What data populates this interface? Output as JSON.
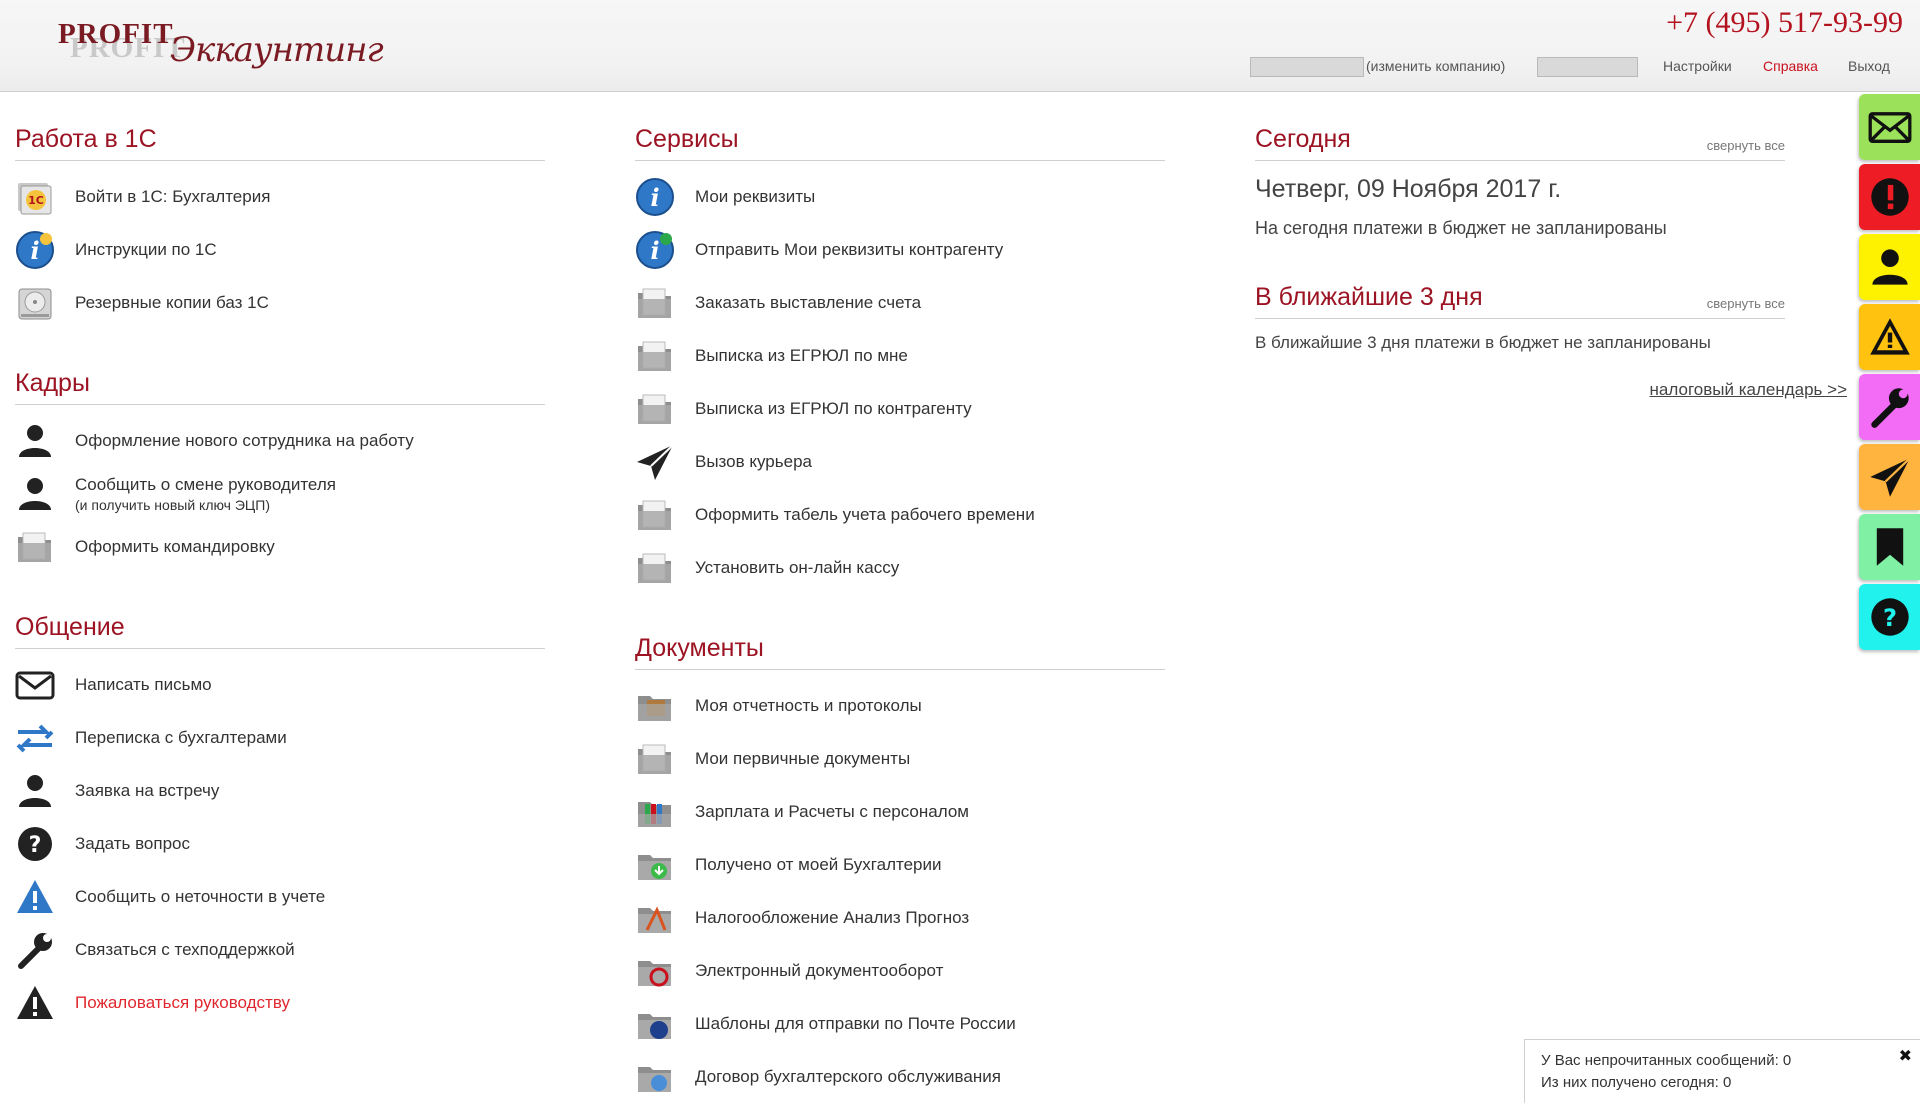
{
  "header": {
    "logo_profit": "PROFIT",
    "logo_script": "Экк­аунтинг",
    "phone": "+7 (495) 517-93-99",
    "change_company": "(изменить компанию)",
    "settings": "Настройки",
    "help": "Справка",
    "logout": "Выход"
  },
  "left": {
    "work_title": "Работа в 1С",
    "work_items": [
      "Войти в 1С: Бухгалтерия",
      "Инструкции по 1С",
      "Резервные копии баз 1С"
    ],
    "hr_title": "Кадры",
    "hr_items": [
      "Оформление нового сотрудника на работу",
      "Сообщить о смене руководителя",
      "(и получить новый ключ ЭЦП)",
      "Оформить командировку"
    ],
    "comm_title": "Общение",
    "comm_items": [
      "Написать письмо",
      "Переписка с бухгалтерами",
      "Заявка на встречу",
      "Задать вопрос",
      "Сообщить о неточности в учете",
      "Связаться с техподдержкой",
      "Пожаловаться руководству"
    ]
  },
  "middle": {
    "services_title": "Сервисы",
    "services_items": [
      "Мои реквизиты",
      "Отправить Мои реквизиты контрагенту",
      "Заказать выставление счета",
      "Выписка из ЕГРЮЛ по мне",
      "Выписка из ЕГРЮЛ по контрагенту",
      "Вызов курьера",
      "Оформить табель учета рабочего времени",
      "Установить он-лайн кассу"
    ],
    "docs_title": "Документы",
    "docs_items": [
      "Моя отчетность и протоколы",
      "Мои первичные документы",
      "Зарплата и Расчеты с персоналом",
      "Получено от моей Бухгалтерии",
      "Налогообложение Анализ Прогноз",
      "Электронный документооборот",
      "Шаблоны для отправки по Почте России",
      "Договор бухгалтерского обслуживания"
    ]
  },
  "right": {
    "today_title": "Сегодня",
    "collapse_all": "свернуть все",
    "today_date": "Четверг, 09 Ноября 2017 г.",
    "today_msg": "На сегодня платежи в бюджет не запланированы",
    "near_title": "В ближайшие 3 дня",
    "near_msg": "В ближайшие 3 дня платежи в бюджет не запланированы",
    "tax_calendar": "налоговый календарь >>"
  },
  "side_tabs": [
    {
      "icon": "envelope-icon",
      "color": "#9be25a"
    },
    {
      "icon": "exclamation-icon",
      "color": "#ee1c24"
    },
    {
      "icon": "person-icon",
      "color": "#fff200"
    },
    {
      "icon": "warning-icon",
      "color": "#ffc20e"
    },
    {
      "icon": "wrench-icon",
      "color": "#f26cf5"
    },
    {
      "icon": "paper-plane-icon",
      "color": "#ffb440"
    },
    {
      "icon": "bookmark-icon",
      "color": "#7ff0a4"
    },
    {
      "icon": "question-icon",
      "color": "#21f2ee"
    }
  ],
  "notice": {
    "line1": "У Вас непрочитанных сообщений: 0",
    "line2": "Из них получено сегодня: 0",
    "close": "✖"
  }
}
